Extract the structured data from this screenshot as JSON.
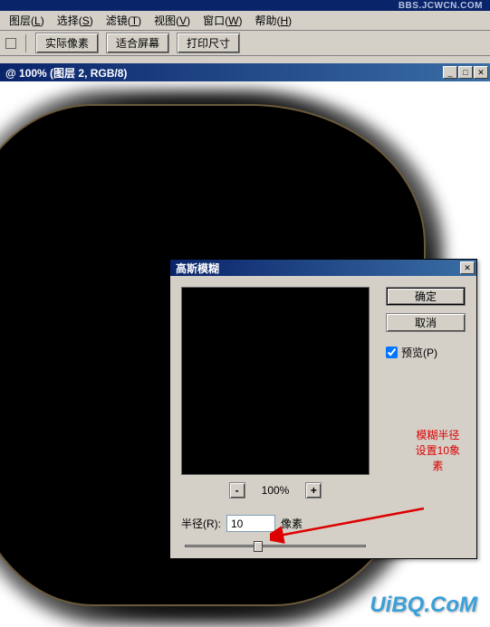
{
  "topbar": {
    "text": "BBS.JCWCN.COM"
  },
  "menu": {
    "items": [
      {
        "label": "图层",
        "key": "L"
      },
      {
        "label": "选择",
        "key": "S"
      },
      {
        "label": "滤镜",
        "key": "T"
      },
      {
        "label": "视图",
        "key": "V"
      },
      {
        "label": "窗口",
        "key": "W"
      },
      {
        "label": "帮助",
        "key": "H"
      }
    ]
  },
  "toolbar": {
    "actual_pixels": "实际像素",
    "fit_screen": "适合屏幕",
    "print_size": "打印尺寸"
  },
  "document": {
    "title": "@ 100% (图层 2, RGB/8)"
  },
  "dialog": {
    "title": "高斯模糊",
    "ok": "确定",
    "cancel": "取消",
    "preview_label": "预览(P)",
    "preview_checked": true,
    "zoom": {
      "minus": "-",
      "value": "100%",
      "plus": "+"
    },
    "radius_label": "半径(R):",
    "radius_value": "10",
    "radius_unit": "像素"
  },
  "annotation": {
    "line1": "模糊半径",
    "line2": "设置10象",
    "line3": "素"
  },
  "watermark": "UiBQ.CoM",
  "colors": {
    "titlebar": "#0a246a",
    "accent": "#3a6ea5",
    "annotation": "#d00"
  }
}
